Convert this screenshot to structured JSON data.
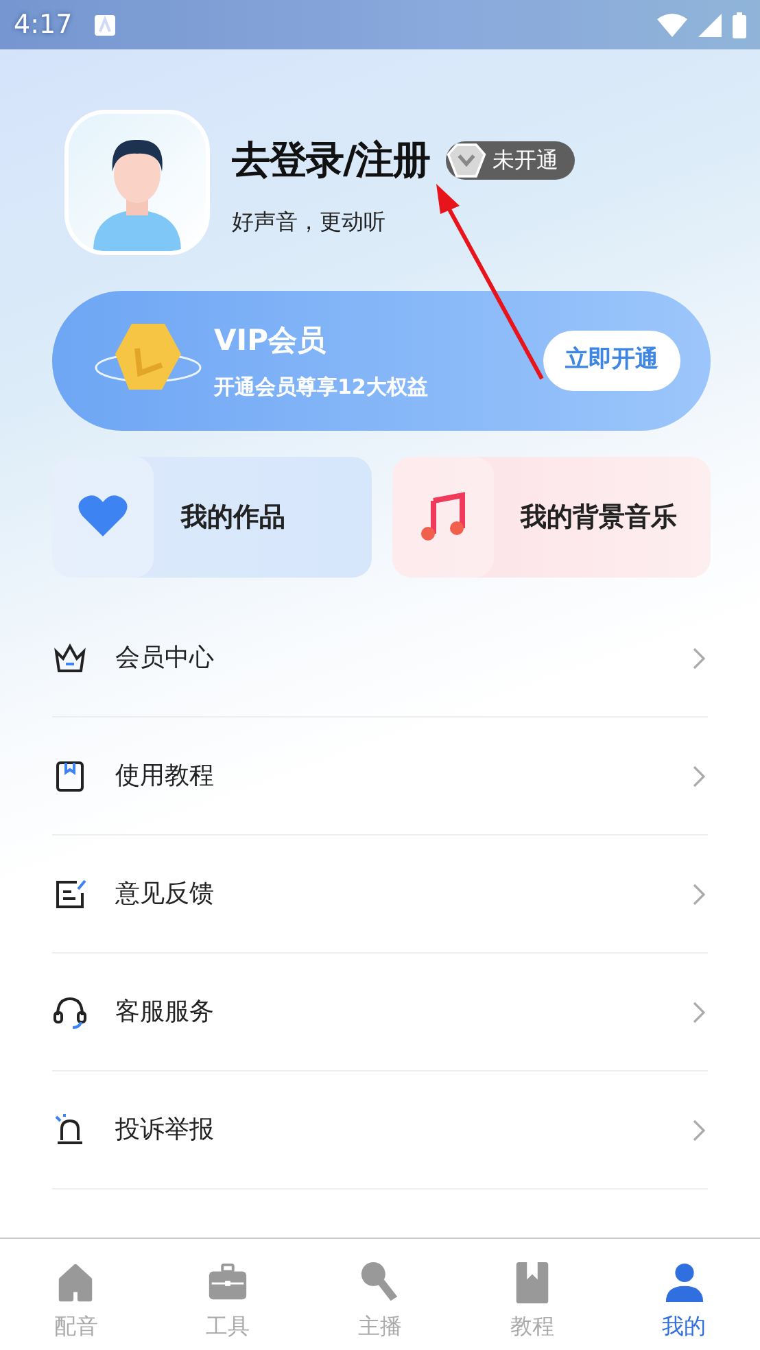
{
  "status_bar": {
    "time": "4:17"
  },
  "profile": {
    "title": "去登录/注册",
    "badge": "未开通",
    "subtitle": "好声音，更动听"
  },
  "vip": {
    "title": "VIP会员",
    "subtitle": "开通会员尊享12大权益",
    "button": "立即开通"
  },
  "tiles": [
    {
      "kind": "works",
      "label": "我的作品"
    },
    {
      "kind": "music",
      "label": "我的背景音乐"
    }
  ],
  "menu": [
    {
      "kind": "crown",
      "label": "会员中心"
    },
    {
      "kind": "book",
      "label": "使用教程"
    },
    {
      "kind": "feedback",
      "label": "意见反馈"
    },
    {
      "kind": "headset",
      "label": "客服服务"
    },
    {
      "kind": "alarm",
      "label": "投诉举报"
    }
  ],
  "tab_bar": [
    {
      "kind": "home",
      "label": "配音",
      "selected": false
    },
    {
      "kind": "tools",
      "label": "工具",
      "selected": false
    },
    {
      "kind": "mic",
      "label": "主播",
      "selected": false
    },
    {
      "kind": "tutorial",
      "label": "教程",
      "selected": false
    },
    {
      "kind": "me",
      "label": "我的",
      "selected": true
    }
  ]
}
